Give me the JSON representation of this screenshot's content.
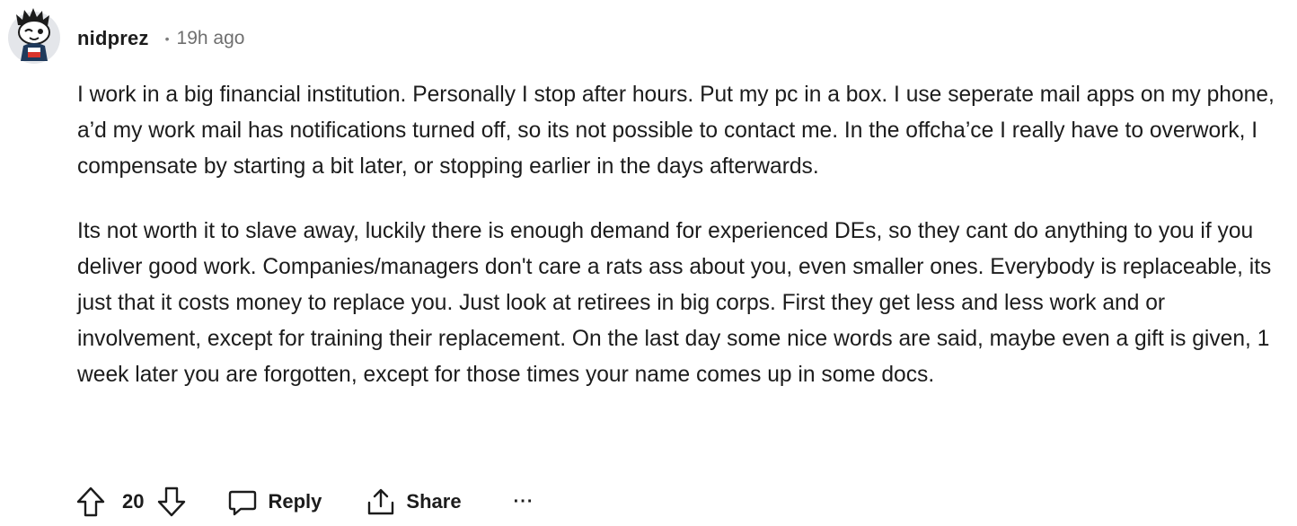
{
  "comment": {
    "author": "nidprez",
    "separator": "•",
    "timestamp": "19h ago",
    "paragraphs": [
      "I work in a big financial institution. Personally I stop after hours. Put my pc in a box. I use seperate mail apps on my phone, a’d my work mail has notifications turned off, so its not possible to contact me. In the offcha’ce I really have to overwork, I compensate by starting a bit later, or stopping earlier in the days afterwards.",
      "Its not worth it to slave away, luckily there is enough demand for experienced DEs, so they cant do anything to you if you deliver good work. Companies/managers don't care a rats ass about you, even smaller ones. Everybody is replaceable, its just that it costs money to replace you. Just look at retirees in big corps. First they get less and less work and or involvement, except for training their replacement. On the last day some nice words are said, maybe even a gift is given, 1 week later you are forgotten, except for those times your name comes up in some docs."
    ]
  },
  "actions": {
    "score": "20",
    "reply_label": "Reply",
    "share_label": "Share",
    "more_label": "···"
  },
  "icons": {
    "upvote": "arrow-up-outline-icon",
    "downvote": "arrow-down-outline-icon",
    "reply": "speech-bubble-icon",
    "share": "share-upload-icon",
    "more": "ellipsis-icon",
    "avatar": "snoo-avatar-icon"
  },
  "colors": {
    "text": "#1c1c1c",
    "muted": "#6f6f6f",
    "avatar_bg": "#e4e6ea",
    "avatar_shirt": "#1f3a5c",
    "avatar_flag_red": "#d9342b"
  }
}
